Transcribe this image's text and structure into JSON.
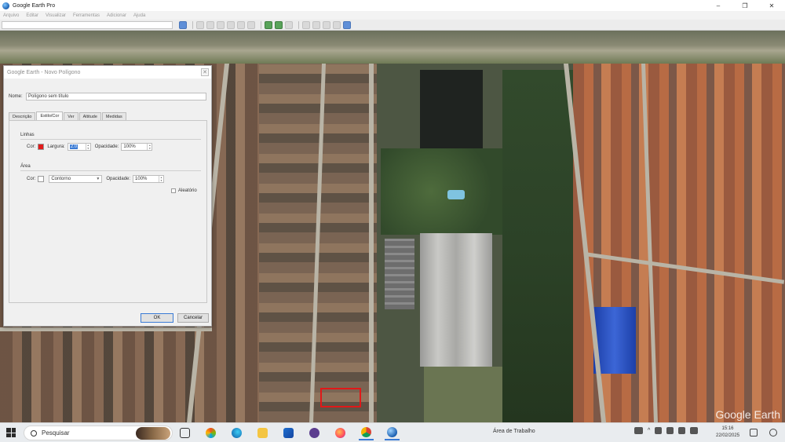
{
  "window": {
    "title": "Google Earth Pro",
    "minimize": "–",
    "maximize": "❐",
    "close": "✕"
  },
  "menu": [
    "Arquivo",
    "Editar",
    "Visualizar",
    "Ferramentas",
    "Adicionar",
    "Ajuda"
  ],
  "dialog": {
    "title": "Google Earth - Novo Polígono",
    "close": "✕",
    "name_label": "Nome:",
    "name_value": "Polígono sem título",
    "tabs": [
      "Descrição",
      "Estilo/Cor",
      "Ver",
      "Altitude",
      "Medidas"
    ],
    "active_tab": "Estilo/Cor",
    "lines": {
      "group": "Linhas",
      "color_label": "Cor:",
      "color": "#e21b1b",
      "width_label": "Largura:",
      "width_value": "2.0",
      "opacity_label": "Opacidade:",
      "opacity_value": "100%"
    },
    "area": {
      "group": "Área",
      "color_label": "Cor:",
      "color": "#ffffff",
      "fill_value": "Contorno",
      "opacity_label": "Opacidade:",
      "opacity_value": "100%",
      "random_label": "Aleatório"
    },
    "ok": "OK",
    "cancel": "Cancelar"
  },
  "map": {
    "highlight_color": "#e01818",
    "logo": "Google Earth"
  },
  "taskbar": {
    "search_placeholder": "Pesquisar",
    "area_label": "Área de Trabalho",
    "time": "15:16",
    "date": "22/02/2025"
  }
}
